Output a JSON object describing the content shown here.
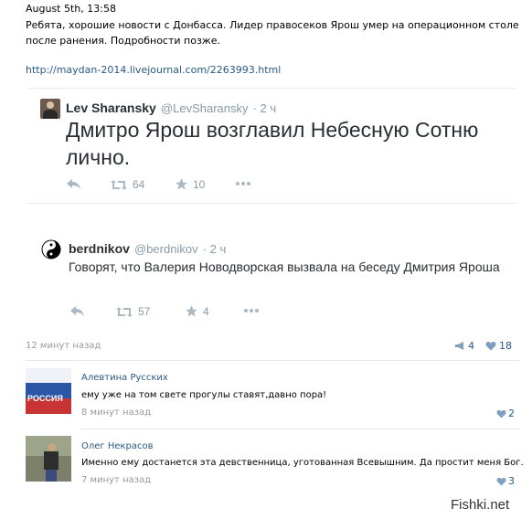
{
  "post": {
    "date": "August 5th, 13:58",
    "text": "Ребята, хорошие новости с Донбасса. Лидер правосеков Ярош умер на операционном столе после ранения. Подробности позже.",
    "link": "http://maydan-2014.livejournal.com/2263993.html"
  },
  "tweet1": {
    "name": "Lev Sharansky",
    "handle": "@LevSharansky",
    "time": "· 2 ч",
    "text": "Дмитро Ярош возглавил Небесную Сотню лично.",
    "retweets": "64",
    "favorites": "10"
  },
  "tweet2": {
    "name": "berdnikov",
    "handle": "@berdnikov",
    "time": "· 2 ч",
    "text": "Говорят, что Валерия Новодворская вызвала на беседу Дмитрия Яроша",
    "retweets": "57",
    "favorites": "4"
  },
  "post_meta": {
    "time": "12 минут назад",
    "reposts": "4",
    "likes": "18"
  },
  "comments": [
    {
      "author": "Алевтина Русских",
      "text": "ему уже на том свете прогулы ставят,давно пора!",
      "time": "8 минут назад",
      "likes": "2",
      "avatar_text": "РОССИЯ"
    },
    {
      "author": "Олег Некрасов",
      "text": "Именно ему достанется эта девственница, уготованная Всевышним. Да простит меня Бог.",
      "time": "7 минут назад",
      "likes": "3"
    }
  ],
  "watermark": "Fishki.net",
  "colors": {
    "link": "#2a5885",
    "twitter_gray": "#8899a6",
    "twitter_text": "#292f33"
  }
}
